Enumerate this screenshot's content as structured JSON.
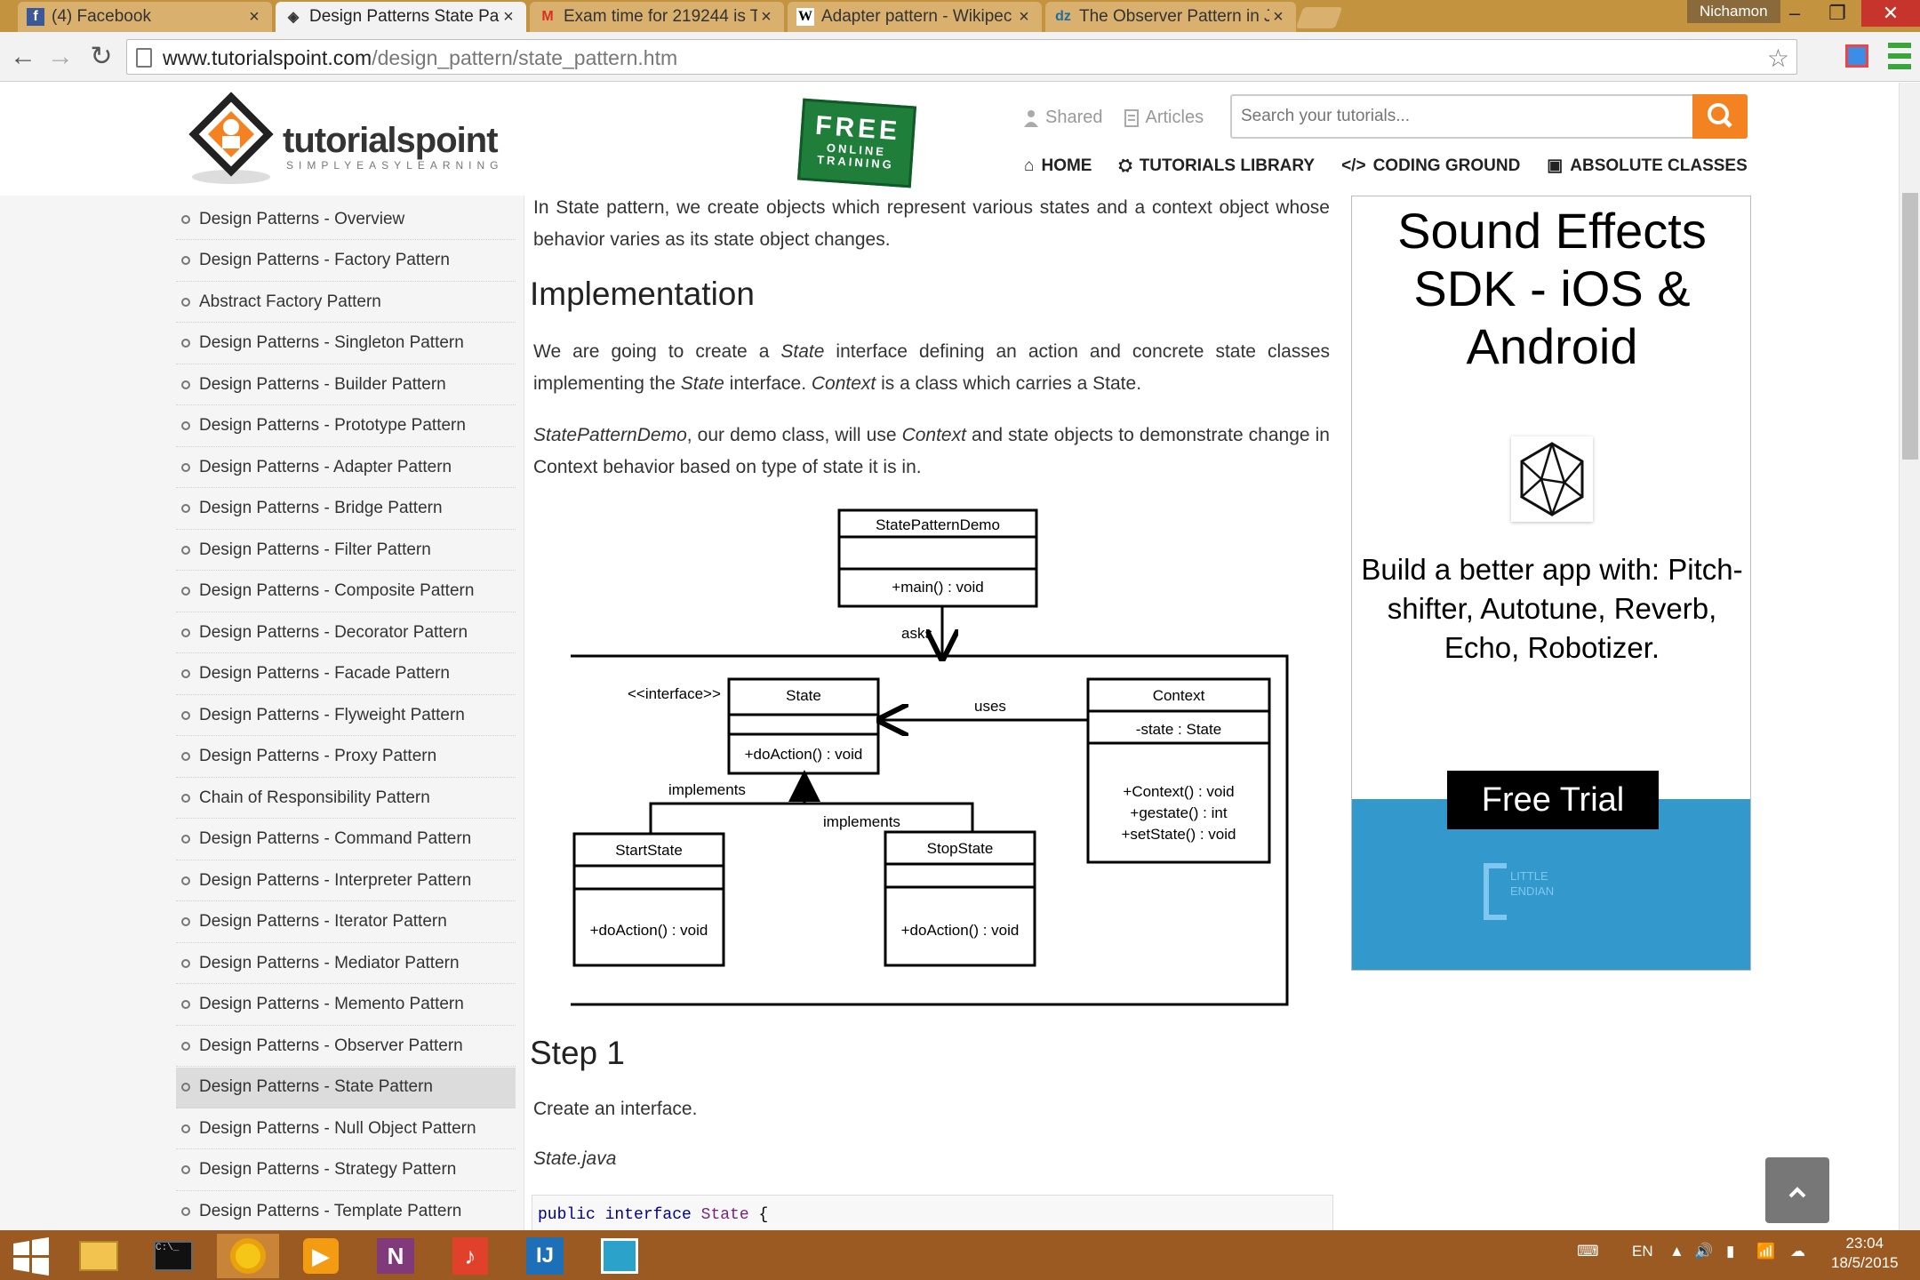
{
  "browser": {
    "tabs": [
      {
        "label": "(4) Facebook",
        "icon": "facebook-icon"
      },
      {
        "label": "Design Patterns State Patt",
        "icon": "tutorialspoint-icon"
      },
      {
        "label": "Exam time for 219244 is T",
        "icon": "gmail-icon"
      },
      {
        "label": "Adapter pattern - Wikipec",
        "icon": "wikipedia-icon"
      },
      {
        "label": "The Observer Pattern in Ja",
        "icon": "dzone-icon"
      }
    ],
    "user": "Nichamon",
    "url_host": "www.tutorialspoint.com",
    "url_path": "/design_pattern/state_pattern.htm"
  },
  "header": {
    "logo_text": "tutorialspoint",
    "logo_tagline": "SIMPLYEASYLEARNING",
    "free_badge": {
      "line1": "FREE",
      "line2": "ONLINE",
      "line3": "TRAINING"
    },
    "links": {
      "shared": "Shared",
      "articles": "Articles"
    },
    "search_placeholder": "Search your tutorials...",
    "nav": {
      "home": "HOME",
      "library": "TUTORIALS LIBRARY",
      "coding": "CODING GROUND",
      "classes": "ABSOLUTE CLASSES"
    }
  },
  "sidebar": {
    "items": [
      "Design Patterns - Overview",
      "Design Patterns - Factory Pattern",
      "Abstract Factory Pattern",
      "Design Patterns - Singleton Pattern",
      "Design Patterns - Builder Pattern",
      "Design Patterns - Prototype Pattern",
      "Design Patterns - Adapter Pattern",
      "Design Patterns - Bridge Pattern",
      "Design Patterns - Filter Pattern",
      "Design Patterns - Composite Pattern",
      "Design Patterns - Decorator Pattern",
      "Design Patterns - Facade Pattern",
      "Design Patterns - Flyweight Pattern",
      "Design Patterns - Proxy Pattern",
      "Chain of Responsibility Pattern",
      "Design Patterns - Command Pattern",
      "Design Patterns - Interpreter Pattern",
      "Design Patterns - Iterator Pattern",
      "Design Patterns - Mediator Pattern",
      "Design Patterns - Memento Pattern",
      "Design Patterns - Observer Pattern",
      "Design Patterns - State Pattern",
      "Design Patterns - Null Object Pattern",
      "Design Patterns - Strategy Pattern",
      "Design Patterns - Template Pattern"
    ],
    "active_index": 21
  },
  "content": {
    "intro": "In State pattern, we create objects which represent various states and a context object whose behavior varies as its state object changes.",
    "impl_heading": "Implementation",
    "impl_p1": {
      "t1": "We are going to create a ",
      "i1": "State",
      "t2": " interface defining an action and concrete state classes implementing the ",
      "i2": "State",
      "t3": " interface. ",
      "i3": "Context",
      "t4": " is a class which carries a State."
    },
    "impl_p2": {
      "i1": "StatePatternDemo",
      "t1": ", our demo class, will use ",
      "i2": "Context",
      "t2": " and state objects to demonstrate change in Context behavior based on type of state it is in."
    },
    "step1_heading": "Step 1",
    "step1_text": "Create an interface.",
    "step1_file": "State.java",
    "code": {
      "kw1": "public",
      "kw2": "interface",
      "type": "State",
      "brace": "{"
    }
  },
  "diagram": {
    "demo_class": "StatePatternDemo",
    "demo_method": "+main() : void",
    "asks": "asks",
    "interface_stereotype": "<<interface>>",
    "state_class": "State",
    "state_method": "+doAction() : void",
    "uses": "uses",
    "context_class": "Context",
    "context_field": "-state : State",
    "context_m1": "+Context() : void",
    "context_m2": "+gestate() : int",
    "context_m3": "+setState() : void",
    "implements1": "implements",
    "implements2": "implements",
    "start_class": "StartState",
    "start_method": "+doAction() : void",
    "stop_class": "StopState",
    "stop_method": "+doAction() : void"
  },
  "ad": {
    "title": "Sound Effects SDK - iOS & Android",
    "subtitle": "Build a better app with: Pitch-shifter, Autotune, Reverb, Echo, Robotizer.",
    "cta": "Free Trial",
    "brand1": "LITTLE",
    "brand2": "ENDIAN"
  },
  "taskbar": {
    "lang": "EN",
    "time": "23:04",
    "date": "18/5/2015"
  },
  "colors": {
    "accent": "#f58220",
    "taskbar": "#9a5a22",
    "tabstrip": "#c4933f"
  }
}
